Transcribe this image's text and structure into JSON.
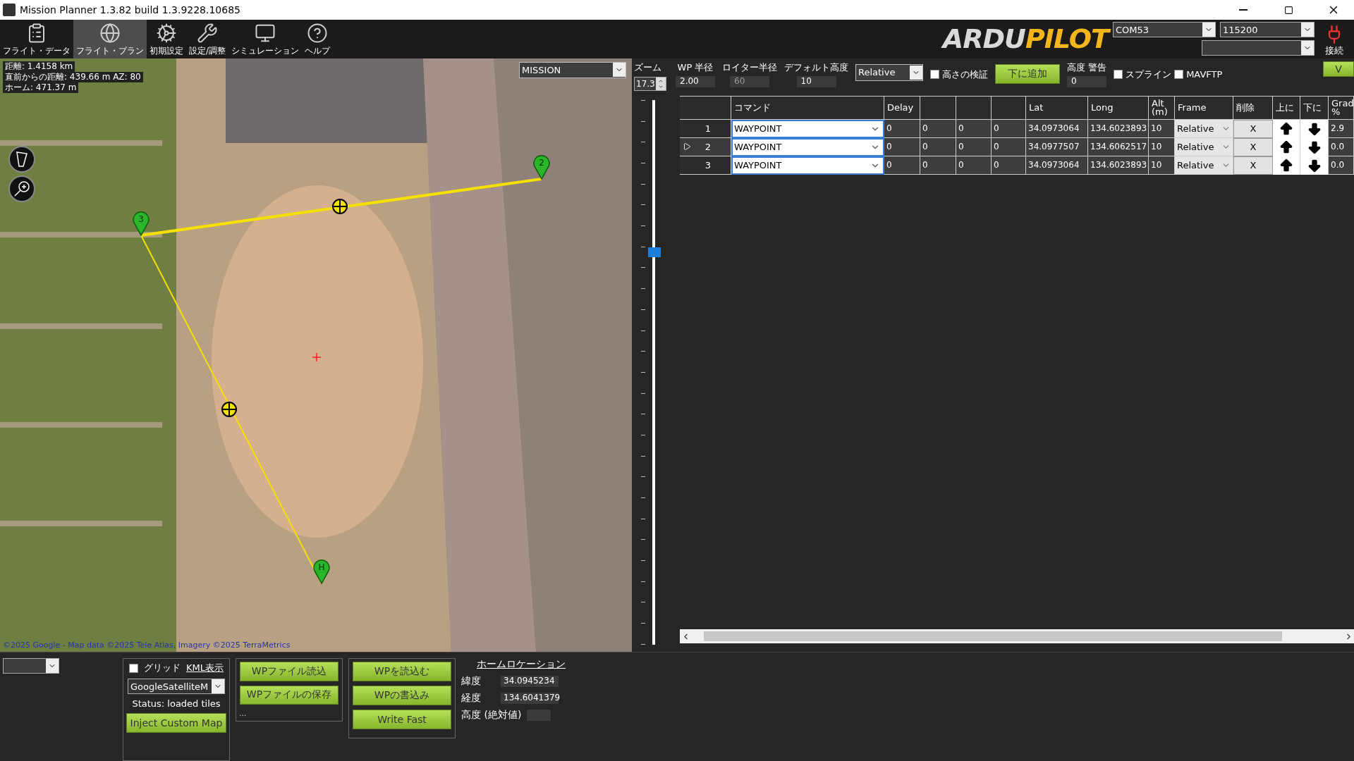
{
  "window": {
    "title": "Mission Planner 1.3.82 build 1.3.9228.10685"
  },
  "menu": [
    {
      "kind": "data",
      "label": "フライト・データ",
      "selected": false
    },
    {
      "kind": "plan",
      "label": "フライト・プラン",
      "selected": true
    },
    {
      "kind": "setup",
      "label": "初期設定",
      "selected": false
    },
    {
      "kind": "config",
      "label": "設定/調整",
      "selected": false
    },
    {
      "kind": "sim",
      "label": "シミュレーション",
      "selected": false
    },
    {
      "kind": "help",
      "label": "ヘルプ",
      "selected": false
    }
  ],
  "logo": {
    "left": "ARDU",
    "right": "PILOT"
  },
  "connection": {
    "port": "COM53",
    "baud": "115200",
    "connect_label": "接続"
  },
  "map": {
    "mode": "MISSION",
    "info": [
      "距離: 1.4158 km",
      "直前からの距離: 439.66 m AZ: 80",
      "ホーム: 471.37 m"
    ],
    "markers": [
      {
        "label": "2"
      },
      {
        "label": "3"
      },
      {
        "label": "H"
      }
    ],
    "attribution": "©2025 Google - Map data ©2025 Tele Atlas, Imagery ©2025 TerraMetrics"
  },
  "zoom": {
    "label": "ズーム",
    "value": "17.3",
    "level": 0.72
  },
  "options": {
    "wp_radius": {
      "label": "WP 半径",
      "value": "2.00"
    },
    "loiter_radius": {
      "label": "ロイター半径",
      "value": "60",
      "disabled": true
    },
    "default_alt": {
      "label": "デフォルト高度",
      "value": "10"
    },
    "frame": "Relative",
    "verify_height": {
      "label": "高さの検証",
      "checked": false
    },
    "add_below": "下に追加",
    "alt_warn": {
      "label": "高度 警告",
      "value": "0"
    },
    "spline": {
      "label": "スプライン",
      "checked": false
    },
    "mavftp": {
      "label": "MAVFTP",
      "checked": false
    },
    "v_button": "V"
  },
  "table": {
    "columns": [
      {
        "kind": "index"
      },
      {
        "kind": "text",
        "label": "コマンド"
      },
      {
        "kind": "text",
        "label": "Delay"
      },
      {
        "kind": "blank"
      },
      {
        "kind": "blank"
      },
      {
        "kind": "blank"
      },
      {
        "kind": "text",
        "label": "Lat"
      },
      {
        "kind": "text",
        "label": "Long"
      },
      {
        "kind": "text",
        "label": "Alt (m)"
      },
      {
        "kind": "text",
        "label": "Frame"
      },
      {
        "kind": "text",
        "label": "削除"
      },
      {
        "kind": "text",
        "label": "上に"
      },
      {
        "kind": "text",
        "label": "下に"
      },
      {
        "kind": "text",
        "label": "Grad %"
      }
    ],
    "rows": [
      {
        "index": "1",
        "selected": false,
        "command": "WAYPOINT",
        "params": [
          "0",
          "0",
          "0",
          "0"
        ],
        "lat": "34.0973064",
        "long": "134.6023893",
        "alt": "10",
        "frame": "Relative",
        "delete": "X",
        "grad": "2.9"
      },
      {
        "index": "2",
        "selected": true,
        "command": "WAYPOINT",
        "params": [
          "0",
          "0",
          "0",
          "0"
        ],
        "lat": "34.0977507",
        "long": "134.6062517",
        "alt": "10",
        "frame": "Relative",
        "delete": "X",
        "grad": "0.0"
      },
      {
        "index": "3",
        "selected": false,
        "command": "WAYPOINT",
        "params": [
          "0",
          "0",
          "0",
          "0"
        ],
        "lat": "34.0973064",
        "long": "134.6023893",
        "alt": "10",
        "frame": "Relative",
        "delete": "X",
        "grad": "0.0"
      }
    ]
  },
  "bottom": {
    "grid": {
      "label": "グリッド",
      "checked": false
    },
    "kml_link": "KML表示",
    "map_provider": "GoogleSatelliteM",
    "status": "Status: loaded tiles",
    "inject_button": "Inject Custom Map",
    "file_buttons": [
      "WPファイル読込",
      "WPファイルの保存"
    ],
    "file_more": "...",
    "wp_buttons": [
      "WPを読込む",
      "WPの書込み",
      "Write Fast"
    ],
    "home": {
      "title": "ホームロケーション",
      "fields": [
        {
          "label": "緯度",
          "value": "34.0945234"
        },
        {
          "label": "経度",
          "value": "134.6041379"
        },
        {
          "label": "高度 (絶対値)"
        }
      ]
    }
  }
}
